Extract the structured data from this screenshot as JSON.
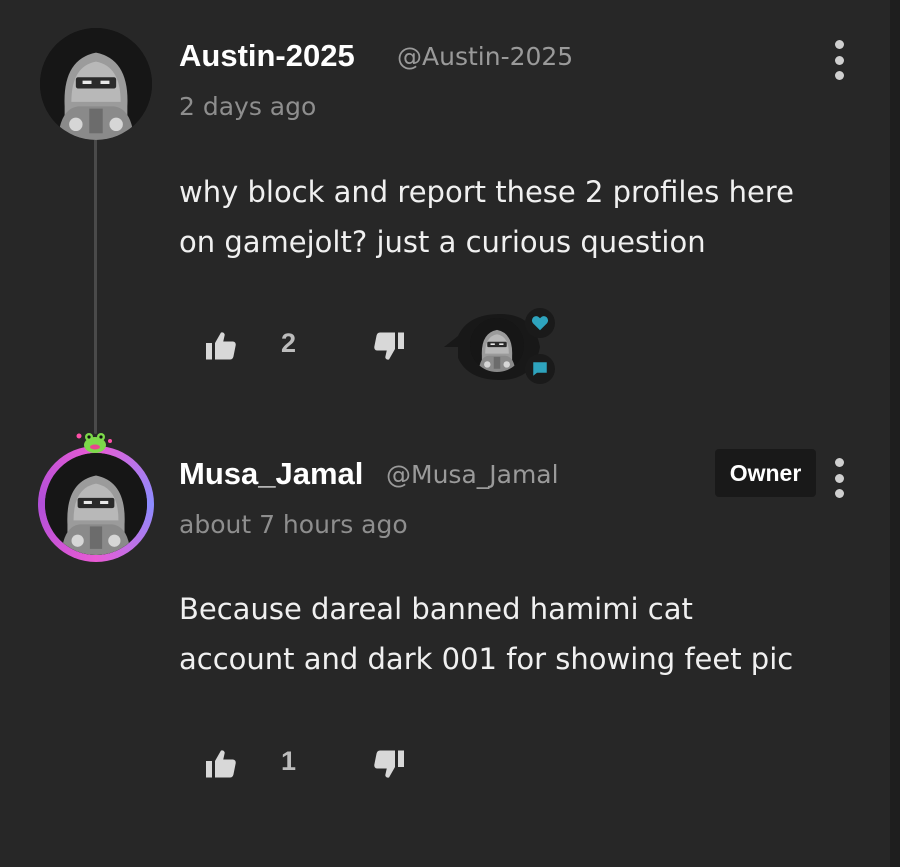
{
  "comments": [
    {
      "author": "Austin-2025",
      "handle": "@Austin-2025",
      "time": "2 days ago",
      "lines": [
        "why block and report these 2 profiles here",
        "on gamejolt? just a curious question"
      ],
      "likes": "2",
      "icons": {
        "avatar": "hooded-figure-avatar",
        "like": "thumbs-up-icon",
        "dislike": "thumbs-down-icon",
        "menu": "kebab-menu-icon"
      }
    },
    {
      "author": "Musa_Jamal",
      "handle": "@Musa_Jamal",
      "time": "about 7 hours ago",
      "badge": "Owner",
      "lines": [
        "Because dareal banned hamimi cat",
        "account and dark 001 for showing feet pic"
      ],
      "likes": "1",
      "icons": {
        "avatar": "hooded-figure-avatar",
        "decoration": "frog-icon",
        "like": "thumbs-up-icon",
        "dislike": "thumbs-down-icon",
        "menu": "kebab-menu-icon"
      }
    }
  ],
  "reply_indicator": {
    "icons": [
      "hooded-figure-avatar",
      "heart-icon",
      "chat-icon"
    ]
  },
  "colors": {
    "background": "#272727",
    "accent_teal": "#2ea3bd",
    "ring_pink": "#e95bd4",
    "badge_bg": "#191919",
    "muted_text": "#8e8e8e"
  }
}
